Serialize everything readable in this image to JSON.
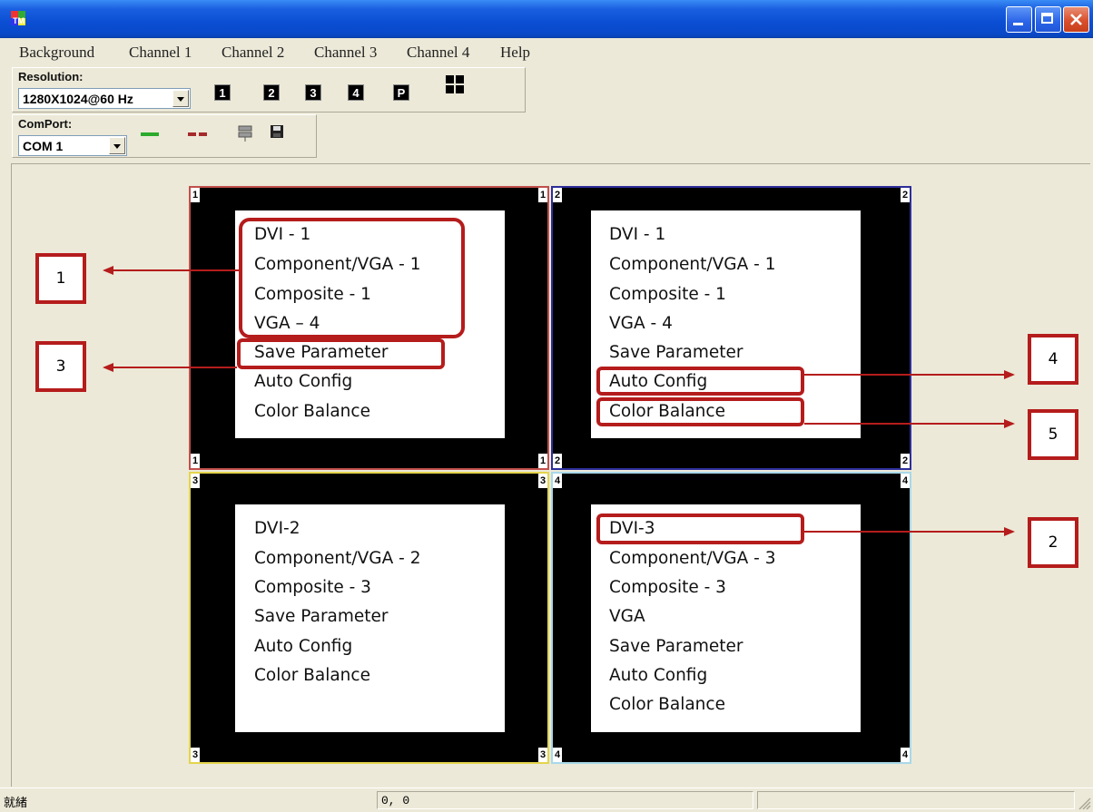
{
  "menu": [
    "Background",
    "Channel 1",
    "Channel 2",
    "Channel 3",
    "Channel 4",
    "Help"
  ],
  "toolbar": {
    "resolution_label": "Resolution:",
    "resolution_value": "1280X1024@60 Hz",
    "channel_buttons": [
      "1",
      "2",
      "3",
      "4",
      "P"
    ],
    "comport_label": "ComPort:",
    "comport_value": "COM 1"
  },
  "panels": [
    {
      "number": "1",
      "items": [
        "DVI - 1",
        "Component/VGA - 1",
        "Composite - 1",
        "VGA – 4",
        "Save Parameter",
        "Auto Config",
        "Color Balance"
      ]
    },
    {
      "number": "2",
      "items": [
        "DVI - 1",
        "Component/VGA - 1",
        "Composite - 1",
        "VGA - 4",
        "Save Parameter",
        "Auto Config",
        "Color Balance"
      ]
    },
    {
      "number": "3",
      "items": [
        "DVI-2",
        "Component/VGA - 2",
        "Composite - 3",
        "Save Parameter",
        "Auto Config",
        "Color Balance"
      ]
    },
    {
      "number": "4",
      "items": [
        "DVI-3",
        "Component/VGA - 3",
        "Composite - 3",
        "VGA",
        "Save Parameter",
        "Auto Config",
        "Color Balance"
      ]
    }
  ],
  "callouts": [
    "1",
    "3",
    "4",
    "5",
    "2"
  ],
  "status": {
    "text": "就緒",
    "coords": "0, 0"
  },
  "colors": {
    "title_bar": "#0B4ED4",
    "callout": "#B51C1C",
    "panel1_border": "#C0504D",
    "panel2_border": "#2E2E9A",
    "panel3_border": "#E4D44B",
    "panel4_border": "#A8D8E8"
  }
}
